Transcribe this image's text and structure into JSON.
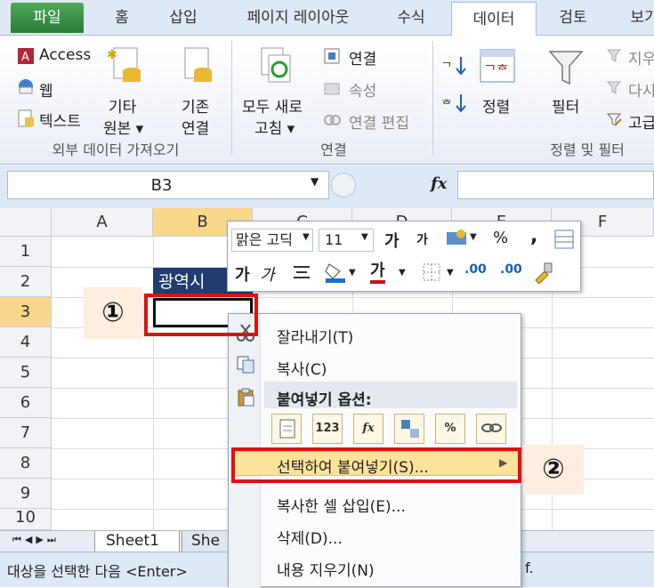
{
  "tabs": [
    "파일",
    "홈",
    "삽입",
    "페이지 레이아웃",
    "수식",
    "데이터",
    "검토",
    "보기"
  ],
  "ribbon": {
    "external": {
      "access": "Access",
      "web": "웹",
      "text": "텍스트",
      "other_l1": "기타",
      "other_l2": "원본 ▾",
      "existing_l1": "기존",
      "existing_l2": "연결",
      "group": "외부 데이터 가져오기"
    },
    "connections": {
      "refresh_l1": "모두 새로",
      "refresh_l2": "고침 ▾",
      "connections": "연결",
      "properties": "속성",
      "edit_links": "연결 편집",
      "group": "연결"
    },
    "sort": {
      "sort": "정렬",
      "filter": "필터",
      "clear": "지우",
      "reapply": "다시",
      "advanced": "고급",
      "group": "정렬 및 필터"
    }
  },
  "formula": {
    "name_box": "B3",
    "fx": "fx"
  },
  "grid": {
    "columns": [
      "A",
      "B",
      "C",
      "D",
      "E",
      "F"
    ],
    "rows": [
      "1",
      "2",
      "3",
      "4",
      "5",
      "6",
      "7",
      "8",
      "9",
      "10"
    ],
    "b2_value": "광역시"
  },
  "mini_toolbar": {
    "font": "맑은 고딕",
    "size": "11",
    "grow": "가",
    "shrink": "가",
    "percent": "%",
    "comma": ",",
    "bold": "가",
    "italic": "가",
    "font_color": "가",
    "inc_dec": ".00",
    "dec_dec": ".00"
  },
  "context_menu": {
    "cut": "잘라내기(T)",
    "copy": "복사(C)",
    "paste_options": "붙여넣기 옵션:",
    "paste_icons": [
      "",
      "123",
      "fx",
      "",
      "%",
      ""
    ],
    "paste_special": "선택하여 붙여넣기(S)...",
    "insert_copied": "복사한 셀 삽입(E)...",
    "delete": "삭제(D)...",
    "clear": "내용 지우기(N)"
  },
  "sheets": [
    "Sheet1",
    "She"
  ],
  "status_text": "대상을 선택한 다음 <Enter>",
  "status_suffix": "f.",
  "annotations": [
    "①",
    "②"
  ],
  "colors": {
    "red_highlight": "#e01010",
    "annotation_bg": "#fdeee0",
    "file_tab": "#2a7d36"
  }
}
